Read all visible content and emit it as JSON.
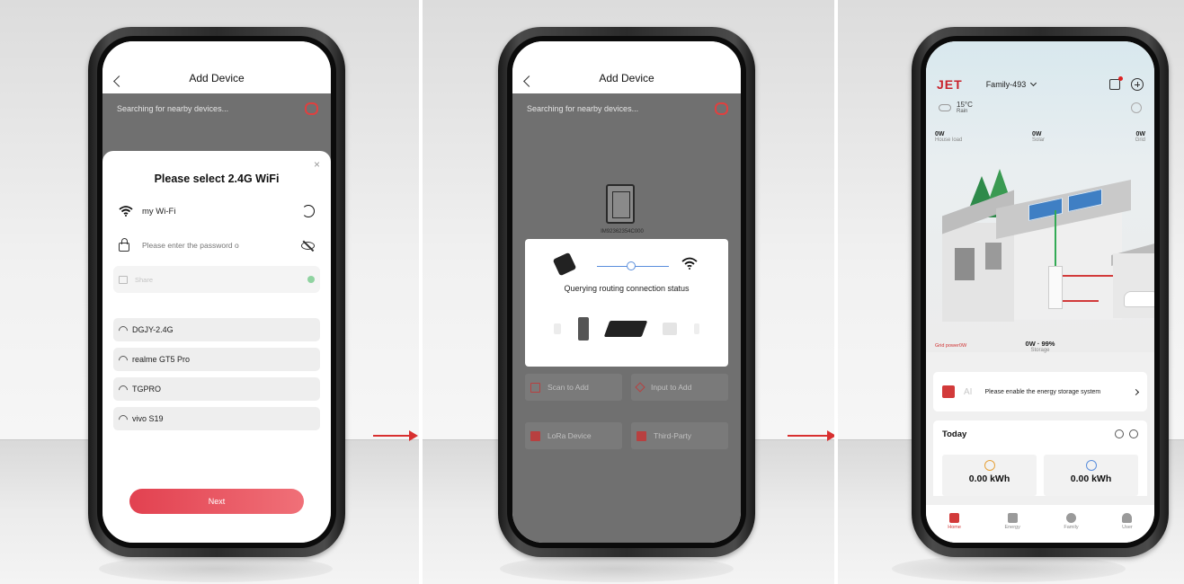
{
  "screen1": {
    "title": "Add Device",
    "search_text": "Searching for nearby devices...",
    "sheet_title": "Please select 2.4G WiFi",
    "close_label": "×",
    "selected_wifi": "my Wi-Fi",
    "password_placeholder": "Please enter the password o",
    "share_label": "Share",
    "networks": [
      "DGJY-2.4G",
      "realme GT5 Pro",
      "TGPRO",
      "vivo S19"
    ],
    "next_label": "Next"
  },
  "screen2": {
    "title": "Add Device",
    "search_text": "Searching for nearby devices...",
    "device_serial": "IM92362354C000",
    "modal_text": "Querying routing connection status",
    "buttons": {
      "scan": "Scan to Add",
      "input": "Input to Add",
      "lora": "LoRa Device",
      "third": "Third-Party"
    }
  },
  "screen3": {
    "logo": "JET",
    "family": "Family-493",
    "weather": {
      "temp": "15°C",
      "condition": "Rain"
    },
    "house_load": {
      "value": "0W",
      "label": "House load"
    },
    "solar": {
      "value": "0W",
      "label": "Solar"
    },
    "grid": {
      "value": "0W",
      "label": "Grid"
    },
    "grid_power": "Grid power0W",
    "storage": {
      "value": "0W · 99%",
      "label": "Storage"
    },
    "ai_label": "AI",
    "ai_text": "Please enable the energy storage system",
    "today_title": "Today",
    "kwh": [
      "0.00 kWh",
      "0.00 kWh"
    ],
    "tabs": [
      "Home",
      "Energy",
      "Family",
      "User"
    ]
  },
  "colors": {
    "accent_red": "#d23a3a",
    "button_gradient_start": "#e24150",
    "button_gradient_end": "#f07078",
    "overlay_gray": "#707070",
    "line_blue": "#5a8edc",
    "line_green": "#33aa55"
  }
}
